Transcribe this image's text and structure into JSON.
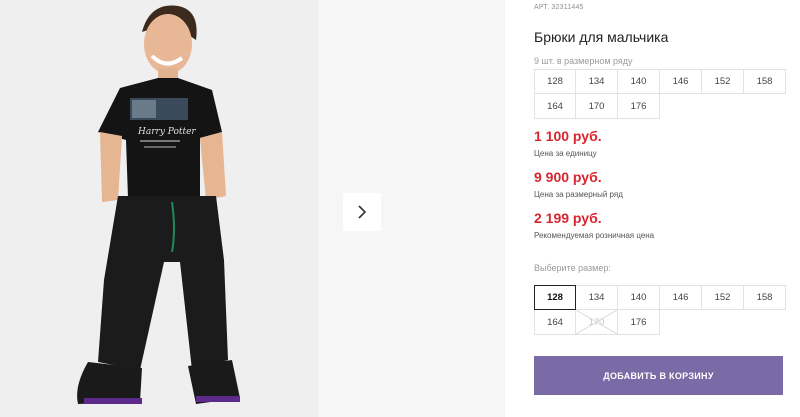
{
  "product": {
    "article": "АРТ. 32311445",
    "title": "Брюки для мальчика",
    "row_note": "9 шт. в размерном ряду",
    "size_row": [
      "128",
      "134",
      "140",
      "146",
      "152",
      "158",
      "164",
      "170",
      "176"
    ]
  },
  "prices": [
    {
      "value": "1 100 руб.",
      "label": "Цена за единицу"
    },
    {
      "value": "9 900 руб.",
      "label": "Цена за размерный ряд"
    },
    {
      "value": "2 199 руб.",
      "label": "Рекомендуемая розничная цена"
    }
  ],
  "size_picker": {
    "label": "Выберите размер:",
    "options": [
      "128",
      "134",
      "140",
      "146",
      "152",
      "158",
      "164",
      "170",
      "176"
    ],
    "selected": "128",
    "unavailable": [
      "170"
    ]
  },
  "cart_button": {
    "label": "ДОБАВИТЬ В КОРЗИНУ"
  },
  "gallery": {
    "next_icon": "chevron-right-icon"
  },
  "colors": {
    "price": "#d9262e",
    "accent": "#7a6aa5"
  }
}
